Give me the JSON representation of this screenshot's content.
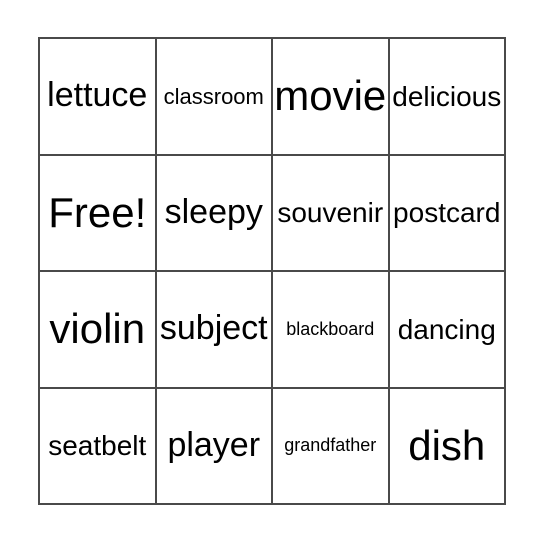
{
  "card": {
    "type": "bingo-card",
    "rows": 4,
    "columns": 4,
    "border_color": "#4a4a4a",
    "text_color": "#000000",
    "background_color": "#ffffff",
    "free_space": "Free!",
    "free_space_position": {
      "row": 2,
      "column": 1
    },
    "cells": [
      {
        "label": "lettuce",
        "row": 1,
        "column": 1,
        "size": "lg"
      },
      {
        "label": "classroom",
        "row": 1,
        "column": 2,
        "size": "sm"
      },
      {
        "label": "movie",
        "row": 1,
        "column": 3,
        "size": "xl"
      },
      {
        "label": "delicious",
        "row": 1,
        "column": 4,
        "size": "md"
      },
      {
        "label": "Free!",
        "row": 2,
        "column": 1,
        "size": "xl"
      },
      {
        "label": "sleepy",
        "row": 2,
        "column": 2,
        "size": "lg"
      },
      {
        "label": "souvenir",
        "row": 2,
        "column": 3,
        "size": "md"
      },
      {
        "label": "postcard",
        "row": 2,
        "column": 4,
        "size": "md"
      },
      {
        "label": "violin",
        "row": 3,
        "column": 1,
        "size": "xl"
      },
      {
        "label": "subject",
        "row": 3,
        "column": 2,
        "size": "lg"
      },
      {
        "label": "blackboard",
        "row": 3,
        "column": 3,
        "size": "xs"
      },
      {
        "label": "dancing",
        "row": 3,
        "column": 4,
        "size": "md"
      },
      {
        "label": "seatbelt",
        "row": 4,
        "column": 1,
        "size": "md"
      },
      {
        "label": "player",
        "row": 4,
        "column": 2,
        "size": "lg"
      },
      {
        "label": "grandfather",
        "row": 4,
        "column": 3,
        "size": "xs"
      },
      {
        "label": "dish",
        "row": 4,
        "column": 4,
        "size": "xl"
      }
    ]
  }
}
